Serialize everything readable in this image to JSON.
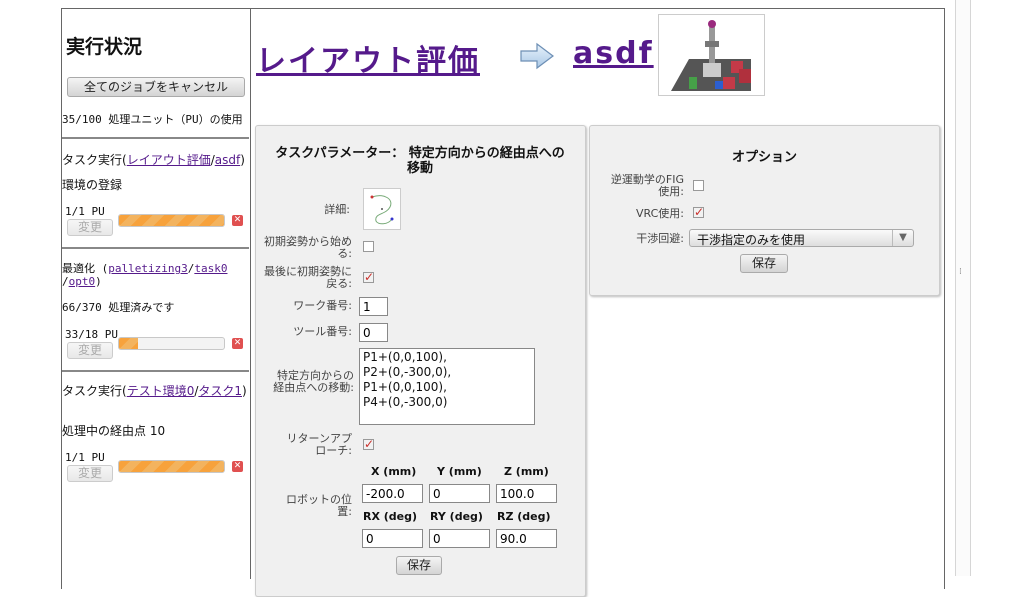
{
  "sidebar": {
    "title": "実行状況",
    "cancel_all": "全てのジョブをキャンセル",
    "usage": "35/100 処理ユニット（PU）の使用",
    "jobs": [
      {
        "prefix": "タスク実行(",
        "link1": "レイアウト評価",
        "sep": "/",
        "link2": "asdf",
        "suffix": ")",
        "status": "環境の登録",
        "pu": "1/1 PU",
        "change": "変更",
        "progress": 1.0
      },
      {
        "prefix": "最適化 (",
        "link1": "palletizing3",
        "sep": "/",
        "link2": "task0",
        "sep2": "/",
        "link3": "opt0",
        "suffix": ")",
        "status": "66/370 処理済みです",
        "pu": "33/18 PU",
        "change": "変更",
        "progress": 0.18
      },
      {
        "prefix": "タスク実行(",
        "link1": "テスト環境0",
        "sep": "/",
        "link2": "タスク1",
        "suffix": ")",
        "status": "処理中の経由点 10",
        "pu": "1/1 PU",
        "change": "変更",
        "progress": 1.0
      }
    ],
    "cancel_glyph": "✕"
  },
  "header": {
    "title": "レイアウト評価",
    "target": "asdf",
    "arrow_icon": "right-arrow-icon"
  },
  "task": {
    "title": "タスクパラメーター：  特定方向からの経由点への移動",
    "detail_label": "詳細:",
    "start_init_label": "初期姿勢から始める:",
    "start_init": false,
    "return_init_label": "最後に初期姿勢に戻る:",
    "return_init": true,
    "work_label": "ワーク番号:",
    "work": "1",
    "tool_label": "ツール番号:",
    "tool": "0",
    "moves_label": "特定方向からの経由点への移動:",
    "moves": "P1+(0,0,100),\nP2+(0,-300,0),\nP1+(0,0,100),\nP4+(0,-300,0)",
    "return_label": "リターンアプローチ:",
    "return_approach": true,
    "pos_label": "ロボットの位置:",
    "headers": [
      "X (mm)",
      "Y (mm)",
      "Z (mm)",
      "RX (deg)",
      "RY (deg)",
      "RZ (deg)"
    ],
    "values": [
      "-200.0",
      "0",
      "100.0",
      "0",
      "0",
      "90.0"
    ],
    "save": "保存"
  },
  "options": {
    "title": "オプション",
    "ik_label": "逆運動学のFIG使用:",
    "ik": false,
    "vrc_label": "VRC使用:",
    "vrc": true,
    "avoid_label": "干渉回避:",
    "avoid": "干渉指定のみを使用",
    "save": "保存"
  }
}
